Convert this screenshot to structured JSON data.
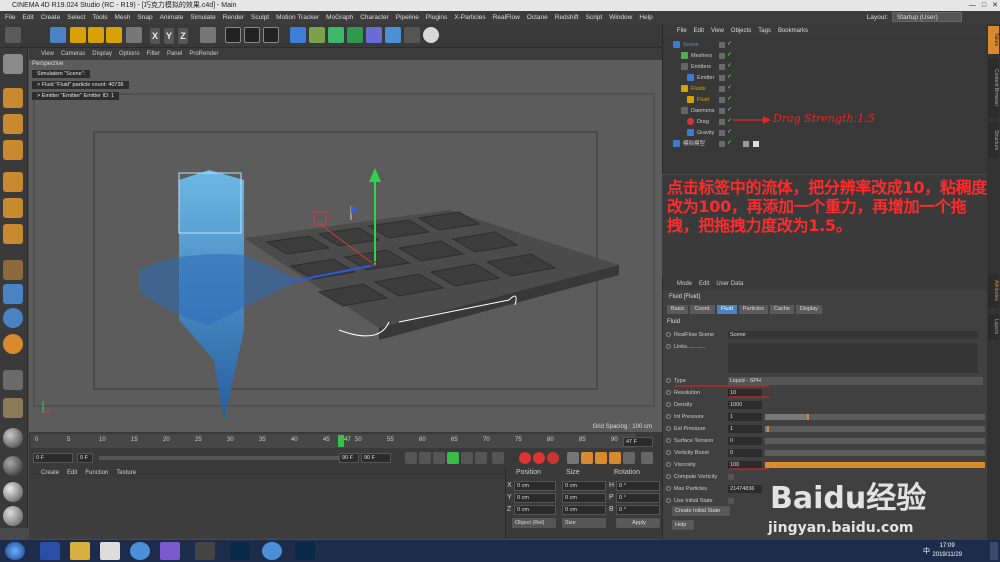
{
  "window": {
    "title": "CINEMA 4D R19.024 Studio (RC - R19) - [巧克力模拟的效果.c4d] - Main"
  },
  "menubar": {
    "items": [
      "File",
      "Edit",
      "Create",
      "Select",
      "Tools",
      "Mesh",
      "Snap",
      "Animate",
      "Simulate",
      "Render",
      "Sculpt",
      "Motion Tracker",
      "MoGraph",
      "Character",
      "Pipeline",
      "Plugins",
      "X-Particles",
      "RealFlow",
      "Octane",
      "Redshift",
      "Script",
      "Window",
      "Help"
    ],
    "layout_label": "Layout:",
    "layout_value": "Startup (User)"
  },
  "toolbar": {
    "axes": [
      "X",
      "Y",
      "Z"
    ]
  },
  "viewport": {
    "menu": [
      "View",
      "Cameras",
      "Display",
      "Options",
      "Filter",
      "Panel",
      "ProRender"
    ],
    "label": "Perspective",
    "hud": [
      "Simulation \"Scene\":",
      "> Fluid \"Fluid\" particle count: 40736",
      "> Emitter \"Emitter\" Emitter ID: 1"
    ],
    "grid_spacing": "Grid Spacing : 100 cm",
    "annotation": "Drag Strength:1.5"
  },
  "timeline": {
    "ticks": [
      "0",
      "5",
      "10",
      "15",
      "20",
      "25",
      "30",
      "35",
      "40",
      "45",
      "50",
      "55",
      "60",
      "65",
      "70",
      "75",
      "80",
      "85",
      "90"
    ],
    "current_marker": "47",
    "frame_end": "47 F",
    "start": "0 F",
    "current": "0 F",
    "end1": "90 F",
    "end2": "90 F"
  },
  "material": {
    "menu": [
      "Create",
      "Edit",
      "Function",
      "Texture"
    ]
  },
  "coords": {
    "headers": [
      "Position",
      "Size",
      "Rotation"
    ],
    "rows": [
      {
        "a": "X",
        "p": "0 cm",
        "s": "0 cm",
        "r": "H",
        "rv": "0 °"
      },
      {
        "a": "Y",
        "p": "0 cm",
        "s": "0 cm",
        "r": "P",
        "rv": "0 °"
      },
      {
        "a": "Z",
        "p": "0 cm",
        "s": "0 cm",
        "r": "B",
        "rv": "0 °"
      }
    ],
    "mode": "Object (Rel)",
    "size_mode": "Size",
    "apply": "Apply"
  },
  "object_manager": {
    "menu": [
      "File",
      "Edit",
      "View",
      "Objects",
      "Tags",
      "Bookmarks"
    ],
    "items": [
      {
        "name": "Scene",
        "indent": 1,
        "color": "#3a7bd5"
      },
      {
        "name": "Meshers",
        "indent": 2,
        "color": "#55aa55"
      },
      {
        "name": "Emitters",
        "indent": 2,
        "color": "#666666"
      },
      {
        "name": "Emitter",
        "indent": 3,
        "color": "#3a7bd5"
      },
      {
        "name": "Fluids",
        "indent": 2,
        "color": "#d3a300"
      },
      {
        "name": "Fluid",
        "indent": 3,
        "color": "#d3a300"
      },
      {
        "name": "Daemons",
        "indent": 2,
        "color": "#666666"
      },
      {
        "name": "Drag",
        "indent": 3,
        "color": "#d33"
      },
      {
        "name": "Gravity",
        "indent": 3,
        "color": "#3a7bd5"
      },
      {
        "name": "模拟模型",
        "indent": 1,
        "color": "#3a7bd5"
      }
    ]
  },
  "note": {
    "text": "点击标签中的流体，把分辨率改成10，粘稠度改为100，再添加一个重力，再增加一个拖拽，把拖拽力度改为1.5。"
  },
  "attributes": {
    "menu": [
      "Mode",
      "Edit",
      "User Data"
    ],
    "header": "Fluid [Fluid]",
    "tabs": [
      "Basic",
      "Coord.",
      "Fluid",
      "Particles",
      "Cache",
      "Display"
    ],
    "section": "Fluid",
    "realflow_scene_label": "RealFlow Scene",
    "realflow_scene_value": "Scene",
    "links_label": "Links............",
    "type_label": "Type",
    "type_value": "Liquid - SPH",
    "rows": [
      {
        "label": "Resolution",
        "value": "10",
        "fill": 0
      },
      {
        "label": "Density",
        "value": "1000",
        "fill": 0
      },
      {
        "label": "Int Pressure",
        "value": "1",
        "fill": 0.2
      },
      {
        "label": "Ext Pressure",
        "value": "1",
        "fill": 0.02
      },
      {
        "label": "Surface Tension",
        "value": "0",
        "fill": 0
      },
      {
        "label": "Vorticity Boost",
        "value": "0",
        "fill": 0
      },
      {
        "label": "Viscosity",
        "value": "100",
        "fill": 1.0
      }
    ],
    "compute_vorticity": "Compute Vorticity",
    "max_particles_label": "Max Particles",
    "max_particles_value": "21474836",
    "use_initial_state": "Use Initial State",
    "create_initial_state": "Create Initial State",
    "help": "Help"
  },
  "right_tabs": [
    "Takes",
    "Content Browser",
    "Structure",
    "Layers",
    "Attributes"
  ],
  "taskbar": {
    "time": "17:09",
    "date": "2019/11/29",
    "ime": "中"
  },
  "watermark": {
    "text": "Baidu经验",
    "url": "jingyan.baidu.com"
  }
}
